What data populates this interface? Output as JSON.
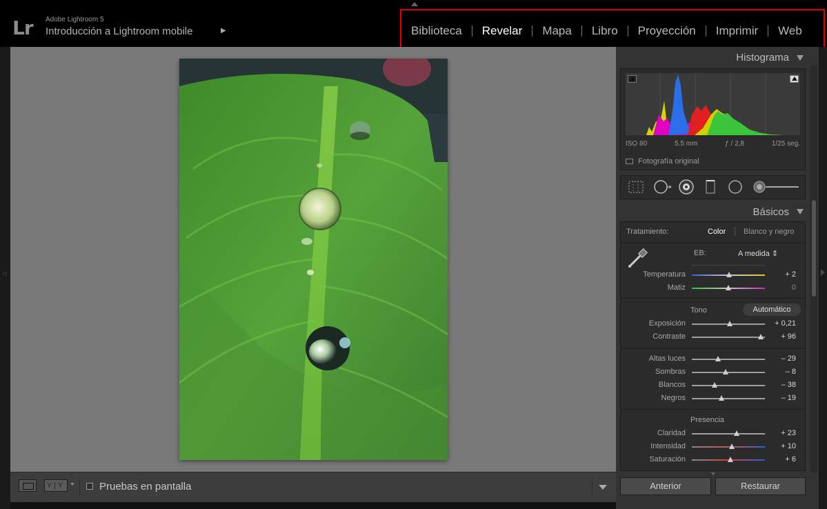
{
  "app": {
    "name": "Adobe Lightroom 5",
    "catalog": "Introducción a Lightroom mobile",
    "logo": "Lr"
  },
  "modules": [
    {
      "label": "Biblioteca",
      "active": false
    },
    {
      "label": "Revelar",
      "active": true
    },
    {
      "label": "Mapa",
      "active": false
    },
    {
      "label": "Libro",
      "active": false
    },
    {
      "label": "Proyección",
      "active": false
    },
    {
      "label": "Imprimir",
      "active": false
    },
    {
      "label": "Web",
      "active": false
    }
  ],
  "toolbar": {
    "proof_label": "Pruebas en pantalla",
    "view_yy": "Y|Y"
  },
  "histogram": {
    "title": "Histograma",
    "iso": "ISO 80",
    "focal": "5.5 mm",
    "aperture": "ƒ / 2,8",
    "shutter": "1/25 seg.",
    "original_label": "Fotografía original"
  },
  "basic": {
    "title": "Básicos",
    "treatment_label": "Tratamiento:",
    "treatment_color": "Color",
    "treatment_bw": "Blanco y negro",
    "wb_label": "EB:",
    "wb_value": "A medida ⇕",
    "tone_label": "Tono",
    "auto_label": "Automático",
    "presence_label": "Presencia",
    "sliders": [
      {
        "label": "Temperatura",
        "value": "+ 2",
        "level": 0.51,
        "track": "temp"
      },
      {
        "label": "Matiz",
        "value": "0",
        "level": 0.5,
        "track": "tint"
      },
      {
        "label": "Exposición",
        "value": "+ 0,21",
        "level": 0.52,
        "track": "plain"
      },
      {
        "label": "Contraste",
        "value": "+ 96",
        "level": 0.94,
        "track": "plain"
      },
      {
        "label": "Altas luces",
        "value": "– 29",
        "level": 0.36,
        "track": "plain"
      },
      {
        "label": "Sombras",
        "value": "– 8",
        "level": 0.46,
        "track": "plain"
      },
      {
        "label": "Blancos",
        "value": "– 38",
        "level": 0.31,
        "track": "plain"
      },
      {
        "label": "Negros",
        "value": "– 19",
        "level": 0.41,
        "track": "plain"
      },
      {
        "label": "Claridad",
        "value": "+ 23",
        "level": 0.61,
        "track": "plain"
      },
      {
        "label": "Intensidad",
        "value": "+ 10",
        "level": 0.55,
        "track": "vib"
      },
      {
        "label": "Saturación",
        "value": "+ 6",
        "level": 0.53,
        "track": "sat"
      }
    ]
  },
  "buttons": {
    "previous": "Anterior",
    "reset": "Restaurar"
  },
  "colors": {
    "accent_red": "#e00000",
    "panel_bg": "#333333",
    "canvas_bg": "#797979"
  }
}
